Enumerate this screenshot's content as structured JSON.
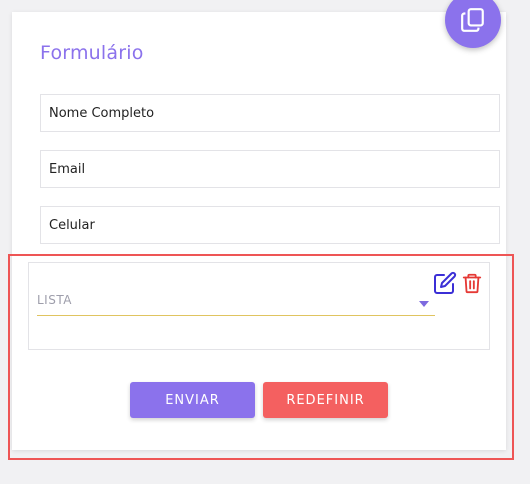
{
  "form": {
    "title": "Formulário",
    "fields": [
      {
        "placeholder": "Nome Completo"
      },
      {
        "placeholder": "Email"
      },
      {
        "placeholder": "Celular"
      }
    ],
    "list": {
      "label": "LISTA"
    }
  },
  "actions": {
    "submit_label": "ENVIAR",
    "reset_label": "REDEFINIR"
  },
  "icons": {
    "fab": "copy-icon",
    "edit": "edit-icon",
    "delete": "trash-icon"
  },
  "colors": {
    "accent": "#8b72ec",
    "danger": "#f46060",
    "edit_icon": "#3b2fd6",
    "delete_icon": "#e53935",
    "underline": "#e0c460",
    "highlight": "#ee5555"
  }
}
